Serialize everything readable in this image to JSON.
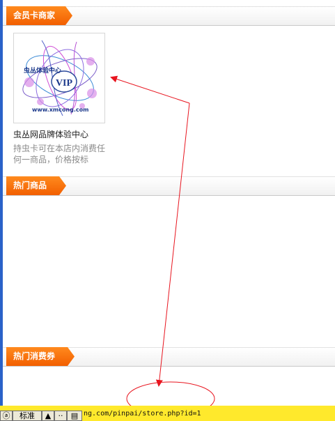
{
  "sections": {
    "member_merchants": {
      "title": "会员卡商家"
    },
    "hot_products": {
      "title": "热门商品"
    },
    "hot_coupons": {
      "title": "热门消费券"
    }
  },
  "merchant": {
    "logo_text_top": "虫丛体验中心",
    "logo_badge": "VIP",
    "logo_url": "www.xmcong.com",
    "name": "虫丛网品牌体验中心",
    "description_line1": "持虫卡可在本店内消费任",
    "description_line2": "何一商品，价格按标"
  },
  "status_bar": {
    "url": "ng.com/pinpai/store.php?id=1",
    "zoom_label": "标准"
  },
  "colors": {
    "tab_orange": "#f25f00",
    "annotation_red": "#e8141e",
    "status_yellow": "#ffe92c",
    "left_bar_blue": "#2a62c9"
  }
}
